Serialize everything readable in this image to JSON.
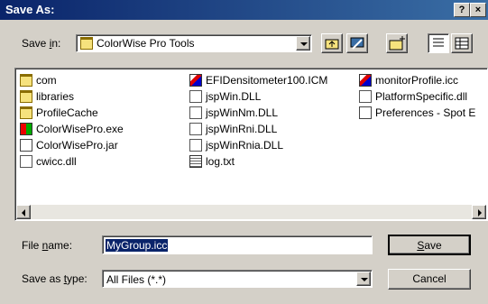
{
  "window": {
    "title": "Save As:",
    "help_button": "?",
    "close_button": "×"
  },
  "save_in": {
    "label_pre": "Save ",
    "label_accel": "i",
    "label_post": "n:",
    "value": "ColorWise Pro Tools"
  },
  "files": [
    {
      "name": "com",
      "icon": "folder-icon"
    },
    {
      "name": "libraries",
      "icon": "folder-icon"
    },
    {
      "name": "ProfileCache",
      "icon": "folder-icon"
    },
    {
      "name": "ColorWisePro.exe",
      "icon": "exe-icon"
    },
    {
      "name": "ColorWisePro.jar",
      "icon": "jar-icon"
    },
    {
      "name": "cwicc.dll",
      "icon": "dll-icon"
    },
    {
      "name": "EFIDensitometer100.ICM",
      "icon": "icm-icon"
    },
    {
      "name": "jspWin.DLL",
      "icon": "dll-icon"
    },
    {
      "name": "jspWinNm.DLL",
      "icon": "dll-icon"
    },
    {
      "name": "jspWinRni.DLL",
      "icon": "dll-icon"
    },
    {
      "name": "jspWinRnia.DLL",
      "icon": "dll-icon"
    },
    {
      "name": "log.txt",
      "icon": "txt-icon"
    },
    {
      "name": "monitorProfile.icc",
      "icon": "icm-icon"
    },
    {
      "name": "PlatformSpecific.dll",
      "icon": "dll-icon"
    },
    {
      "name": "Preferences - Spot E",
      "icon": "jar-icon"
    }
  ],
  "file_name": {
    "label_pre": "File ",
    "label_accel": "n",
    "label_post": "ame:",
    "value": "MyGroup.icc"
  },
  "save_type": {
    "label_pre": "Save as ",
    "label_accel": "t",
    "label_post": "ype:",
    "value": "All Files (*.*)"
  },
  "buttons": {
    "save_accel": "S",
    "save_rest": "ave",
    "cancel": "Cancel"
  }
}
